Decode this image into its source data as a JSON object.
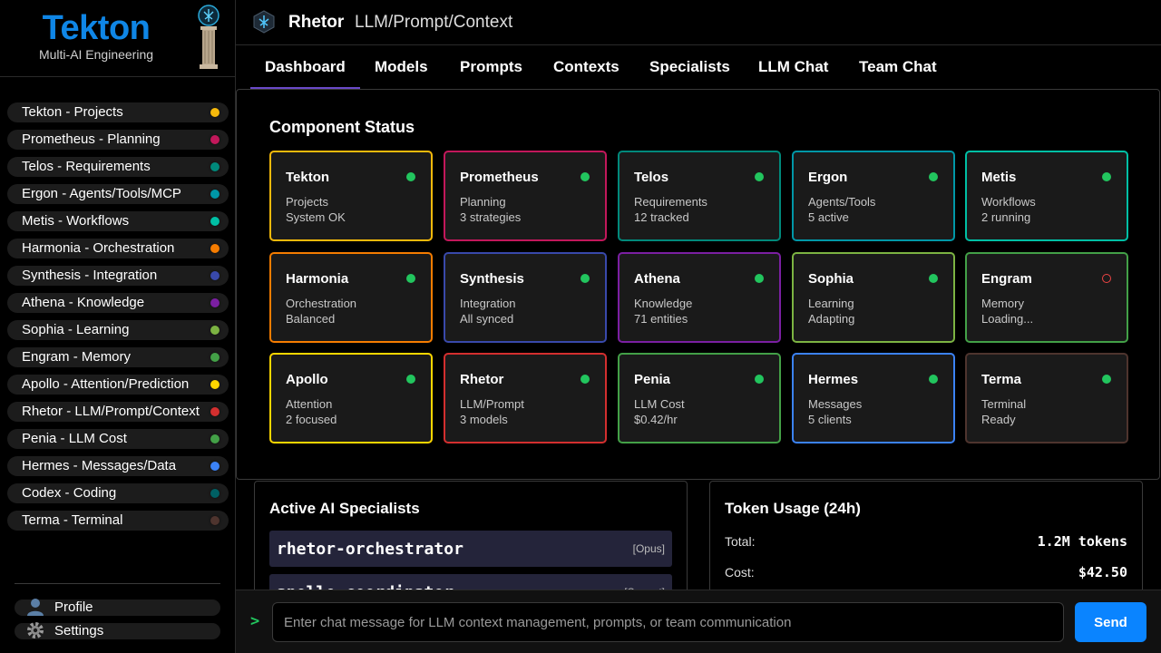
{
  "brand": {
    "title": "Tekton",
    "subtitle": "Multi-AI Engineering"
  },
  "sidebar": {
    "items": [
      {
        "label": "Tekton - Projects",
        "color": "#f5b90b"
      },
      {
        "label": "Prometheus - Planning",
        "color": "#c2185b"
      },
      {
        "label": "Telos - Requirements",
        "color": "#00897b"
      },
      {
        "label": "Ergon - Agents/Tools/MCP",
        "color": "#0097a7"
      },
      {
        "label": "Metis - Workflows",
        "color": "#00bfa5"
      },
      {
        "label": "Harmonia - Orchestration",
        "color": "#f57c00"
      },
      {
        "label": "Synthesis - Integration",
        "color": "#3949ab"
      },
      {
        "label": "Athena - Knowledge",
        "color": "#7b1fa2"
      },
      {
        "label": "Sophia - Learning",
        "color": "#7cb342"
      },
      {
        "label": "Engram - Memory",
        "color": "#43a047"
      },
      {
        "label": "Apollo - Attention/Prediction",
        "color": "#ffd600"
      },
      {
        "label": "Rhetor - LLM/Prompt/Context",
        "color": "#d32f2f"
      },
      {
        "label": "Penia - LLM Cost",
        "color": "#43a047"
      },
      {
        "label": "Hermes - Messages/Data",
        "color": "#3b82f6"
      },
      {
        "label": "Codex - Coding",
        "color": "#006064"
      },
      {
        "label": "Terma - Terminal",
        "color": "#4e342e"
      }
    ],
    "profile_label": "Profile",
    "settings_label": "Settings"
  },
  "header": {
    "name": "Rhetor",
    "subtitle": "LLM/Prompt/Context"
  },
  "tabs": [
    {
      "label": "Dashboard",
      "active": true
    },
    {
      "label": "Models"
    },
    {
      "label": "Prompts"
    },
    {
      "label": "Contexts"
    },
    {
      "label": "Specialists"
    },
    {
      "label": "LLM Chat"
    },
    {
      "label": "Team Chat"
    }
  ],
  "component_status": {
    "title": "Component Status",
    "cards": [
      {
        "name": "Tekton",
        "line1": "Projects",
        "line2": "System OK",
        "color": "#f5b90b",
        "online": true
      },
      {
        "name": "Prometheus",
        "line1": "Planning",
        "line2": "3 strategies",
        "color": "#c2185b",
        "online": true
      },
      {
        "name": "Telos",
        "line1": "Requirements",
        "line2": "12 tracked",
        "color": "#00897b",
        "online": true
      },
      {
        "name": "Ergon",
        "line1": "Agents/Tools",
        "line2": "5 active",
        "color": "#0097a7",
        "online": true
      },
      {
        "name": "Metis",
        "line1": "Workflows",
        "line2": "2 running",
        "color": "#00bfa5",
        "online": true
      },
      {
        "name": "Harmonia",
        "line1": "Orchestration",
        "line2": "Balanced",
        "color": "#f57c00",
        "online": true
      },
      {
        "name": "Synthesis",
        "line1": "Integration",
        "line2": "All synced",
        "color": "#3949ab",
        "online": true
      },
      {
        "name": "Athena",
        "line1": "Knowledge",
        "line2": "71 entities",
        "color": "#7b1fa2",
        "online": true
      },
      {
        "name": "Sophia",
        "line1": "Learning",
        "line2": "Adapting",
        "color": "#7cb342",
        "online": true
      },
      {
        "name": "Engram",
        "line1": "Memory",
        "line2": "Loading...",
        "color": "#43a047",
        "online": false
      },
      {
        "name": "Apollo",
        "line1": "Attention",
        "line2": "2 focused",
        "color": "#ffd600",
        "online": true
      },
      {
        "name": "Rhetor",
        "line1": "LLM/Prompt",
        "line2": "3 models",
        "color": "#d32f2f",
        "online": true
      },
      {
        "name": "Penia",
        "line1": "LLM Cost",
        "line2": "$0.42/hr",
        "color": "#43a047",
        "online": true
      },
      {
        "name": "Hermes",
        "line1": "Messages",
        "line2": "5 clients",
        "color": "#3b82f6",
        "online": true
      },
      {
        "name": "Terma",
        "line1": "Terminal",
        "line2": "Ready",
        "color": "#4e342e",
        "online": true
      }
    ]
  },
  "specialists": {
    "title": "Active AI Specialists",
    "items": [
      {
        "name": "rhetor-orchestrator",
        "model": "[Opus]"
      },
      {
        "name": "apollo-coordinator",
        "model": "[Sonnet]"
      }
    ]
  },
  "token_usage": {
    "title": "Token Usage (24h)",
    "total_label": "Total:",
    "total_value": "1.2M tokens",
    "cost_label": "Cost:",
    "cost_value": "$42.50"
  },
  "chat": {
    "prompt_symbol": ">",
    "placeholder": "Enter chat message for LLM context management, prompts, or team communication",
    "send_label": "Send"
  }
}
